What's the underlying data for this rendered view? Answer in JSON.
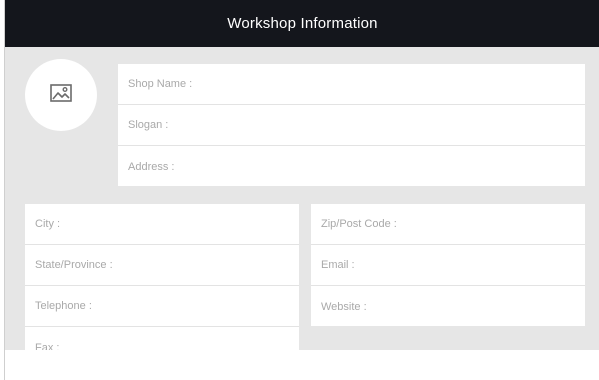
{
  "header": {
    "title": "Workshop Information"
  },
  "logo": {
    "icon": "image-icon"
  },
  "shop_card": {
    "shop_name_label": "Shop Name :",
    "slogan_label": "Slogan :",
    "address_label": "Address :"
  },
  "contact_left": {
    "city_label": "City :",
    "state_label": "State/Province :",
    "telephone_label": "Telephone :",
    "fax_label": "Fax :"
  },
  "contact_right": {
    "zip_label": "Zip/Post Code :",
    "email_label": "Email :",
    "website_label": "Website :"
  },
  "colors": {
    "header_bg": "#14161c",
    "header_text": "#ffffff",
    "content_bg": "#e6e6e6",
    "card_bg": "#ffffff",
    "label_text": "#a9a9a9"
  }
}
